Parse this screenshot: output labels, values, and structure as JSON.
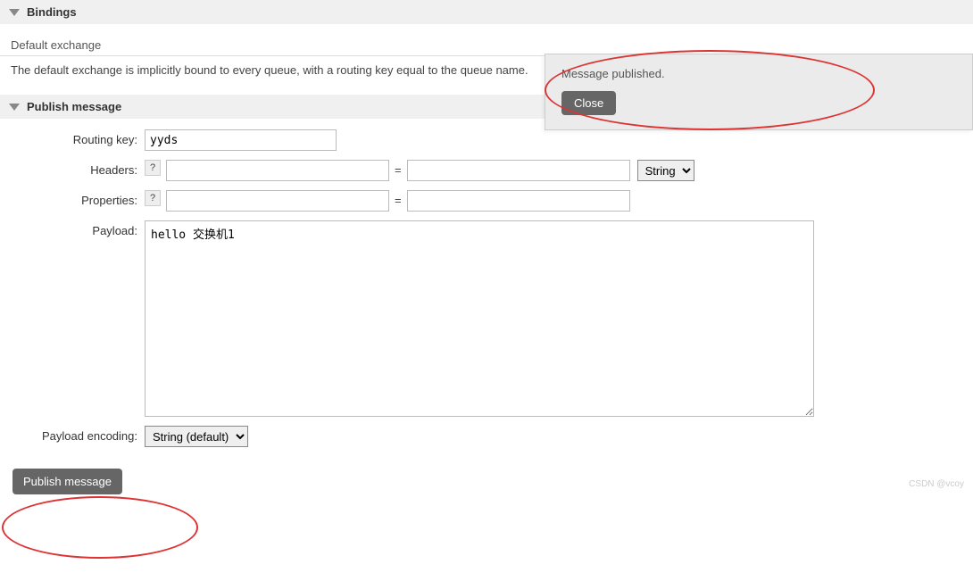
{
  "sections": {
    "bindings": {
      "title": "Bindings",
      "subtitle": "Default exchange",
      "description": "The default exchange is implicitly bound to every queue, with a routing key equal to the queue name."
    },
    "publish": {
      "title": "Publish message",
      "labels": {
        "routing_key": "Routing key:",
        "headers": "Headers:",
        "properties": "Properties:",
        "payload": "Payload:",
        "payload_encoding": "Payload encoding:"
      },
      "help_char": "?",
      "routing_key_value": "yyds",
      "headers_key": "",
      "headers_value": "",
      "headers_type_options": [
        "String"
      ],
      "headers_type_selected": "String",
      "properties_key": "",
      "properties_value": "",
      "payload_value": "hello 交换机1",
      "encoding_options": [
        "String (default)"
      ],
      "encoding_selected": "String (default)",
      "button": "Publish message"
    }
  },
  "notification": {
    "message": "Message published.",
    "close": "Close"
  },
  "watermark": "CSDN @vcoy"
}
